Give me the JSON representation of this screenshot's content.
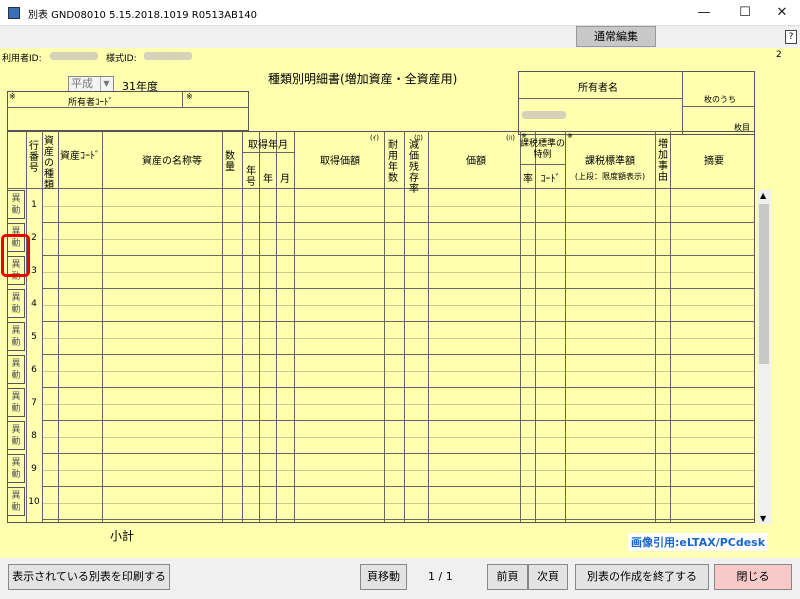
{
  "window": {
    "title": "別表 GND08010 5.15.2018.1019 R0513AB140",
    "min": "—",
    "max": "☐",
    "close": "✕"
  },
  "toolbar": {
    "mode_button": "通常編集",
    "help": "?"
  },
  "form": {
    "page_number": "2",
    "user_id_label": "利用者ID:",
    "form_id_label": "様式ID:",
    "era": "平成",
    "year": "31年度",
    "doc_title": "種類別明細書(増加資産・全資産用)",
    "owner_name_label": "所有者名",
    "owner_code_label": "所有者ｺｰﾄﾞ",
    "mark": "※",
    "sheet_of_label": "枚のうち",
    "sheet_label": "枚目",
    "headers": {
      "line_no": "行番号",
      "asset_type": "資産の種類",
      "asset_code": "資産ｺｰﾄﾞ",
      "asset_name": "資産の名称等",
      "quantity": "数量",
      "acq_date": "取得年月",
      "era_col": "年号",
      "year_col": "年",
      "month_col": "月",
      "acq_price": "取得価額",
      "acq_price_mark": "(ｲ)",
      "life": "耐用年数",
      "residual": "減価残存率",
      "residual_mark": "(ﾛ)",
      "value": "価額",
      "value_mark": "(ﾊ)",
      "special": "課税標準の特例",
      "rate": "率",
      "code": "ｺｰﾄﾞ",
      "tax_base": "課税標準額",
      "tax_base_sub": "(上段：限度額表示)",
      "increase_reason": "増加事由",
      "remarks": "摘要"
    },
    "rows": [
      {
        "no": "1",
        "btn": "異動"
      },
      {
        "no": "2",
        "btn": "異動"
      },
      {
        "no": "3",
        "btn": "異動"
      },
      {
        "no": "4",
        "btn": "異動"
      },
      {
        "no": "5",
        "btn": "異動"
      },
      {
        "no": "6",
        "btn": "異動"
      },
      {
        "no": "7",
        "btn": "異動"
      },
      {
        "no": "8",
        "btn": "異動"
      },
      {
        "no": "9",
        "btn": "異動"
      },
      {
        "no": "10",
        "btn": "異動"
      }
    ],
    "subtotal_label": "小計"
  },
  "bottom": {
    "print_button": "表示されている別表を印刷する",
    "page_move_button": "頁移動",
    "page_indicator": "1 / 1",
    "prev_button": "前頁",
    "next_button": "次頁",
    "finish_button": "別表の作成を終了する",
    "close_button": "閉じる"
  },
  "credit": "画像引用:eLTAX/PCdesk"
}
